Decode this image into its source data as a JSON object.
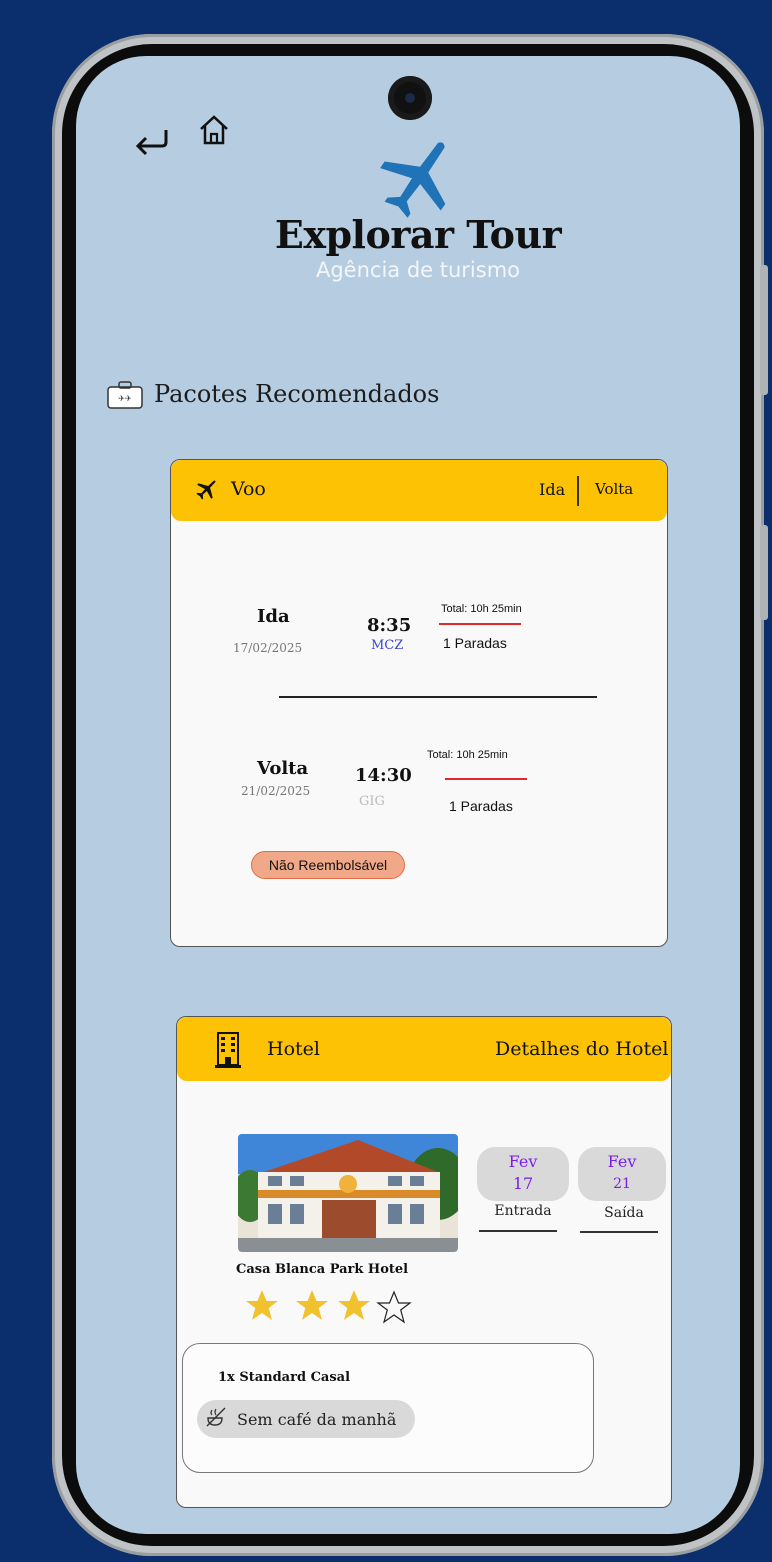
{
  "brand": {
    "title": "Explorar Tour",
    "subtitle": "Agência de turismo"
  },
  "nav": {
    "back_icon": "return-arrow-icon",
    "home_icon": "home-icon"
  },
  "section": {
    "title": "Pacotes Recomendados",
    "icon": "luggage-icon"
  },
  "flight_card": {
    "header_label": "Voo",
    "tab_outbound": "Ida",
    "tab_return": "Volta",
    "outbound": {
      "label": "Ida",
      "date": "17/02/2025",
      "time": "8:35",
      "airport": "MCZ",
      "total": "Total: 10h 25min",
      "stops": "1 Paradas"
    },
    "inbound": {
      "label": "Volta",
      "date": "21/02/2025",
      "time": "14:30",
      "airport": "GIG",
      "total": "Total: 10h 25min",
      "stops": "1 Paradas"
    },
    "refund_badge": "Não Reembolsável"
  },
  "hotel_card": {
    "header_label": "Hotel",
    "details_link": "Detalhes do Hotel",
    "hotel_name": "Casa Blanca Park Hotel",
    "rating": 3,
    "rating_max": 5,
    "checkin": {
      "month": "Fev",
      "day": "17",
      "caption": "Entrada"
    },
    "checkout": {
      "month": "Fev",
      "day": "21",
      "caption": "Saída"
    },
    "room": "1x Standard Casal",
    "breakfast": "Sem café da manhã"
  },
  "colors": {
    "screen_bg": "#b6cde1",
    "accent_yellow": "#fcc203",
    "plane_blue": "#1f73b6",
    "date_purple": "#7a1ee6",
    "badge_orange": "#f0a889"
  }
}
